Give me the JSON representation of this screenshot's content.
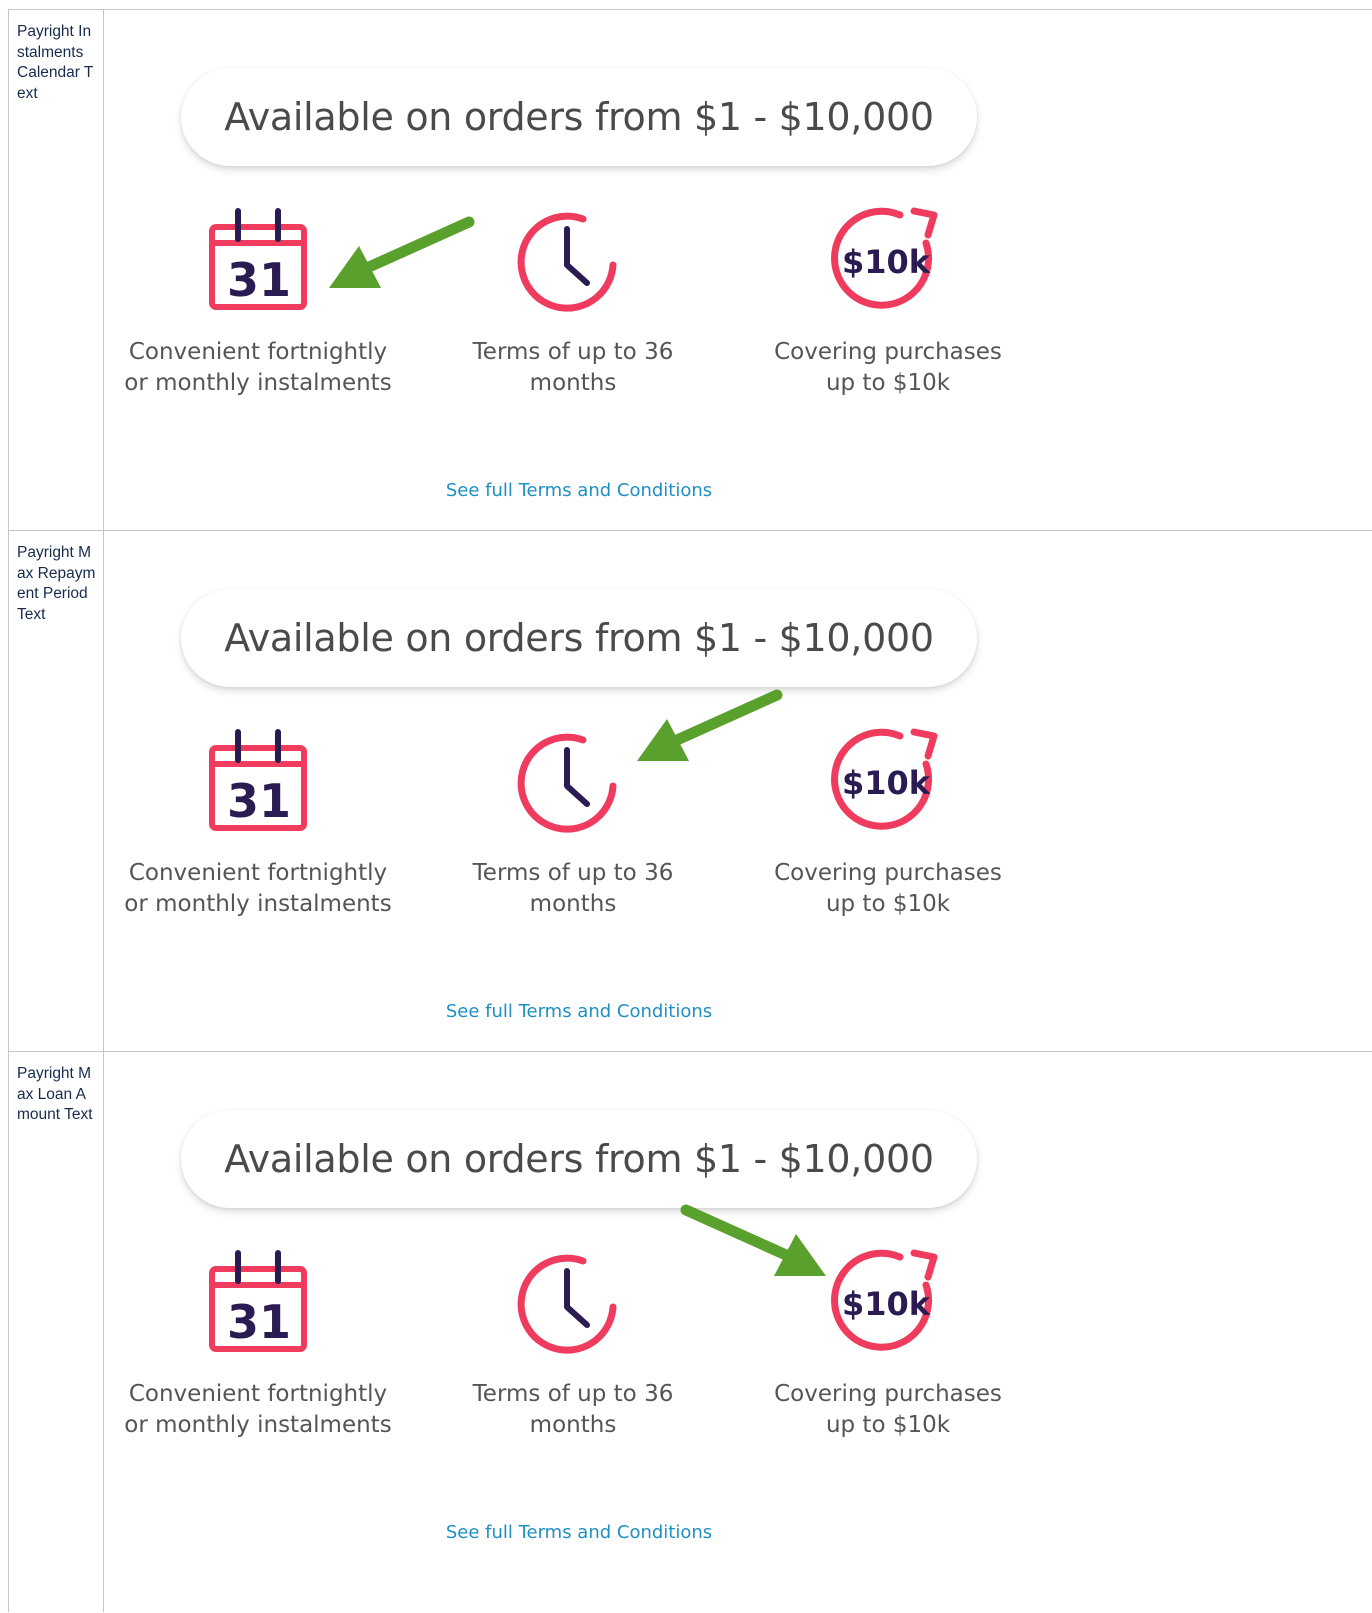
{
  "colors": {
    "accent_red": "#ef3b5d",
    "icon_navy": "#2a1c52",
    "arrow_green": "#5aa02c",
    "link_blue": "#1f8fc4",
    "border": "#c1c7d0"
  },
  "rows": [
    {
      "label": "Payright Instalments Calendar Text",
      "banner": "Available on orders from $1 - $10,000",
      "features": [
        {
          "icon": "calendar-icon",
          "badge": "31",
          "caption": "Convenient fortnightly or monthly instalments"
        },
        {
          "icon": "clock-icon",
          "caption": "Terms of up to 36 months"
        },
        {
          "icon": "dollar-10k-icon",
          "badge": "$10k",
          "caption": "Covering purchases up to $10k"
        }
      ],
      "link": "See full Terms and Conditions",
      "highlighted": "calendar-icon"
    },
    {
      "label": "Payright Max Repayment Period Text",
      "banner": "Available on orders from $1 - $10,000",
      "features": [
        {
          "icon": "calendar-icon",
          "badge": "31",
          "caption": "Convenient fortnightly or monthly instalments"
        },
        {
          "icon": "clock-icon",
          "caption": "Terms of up to 36 months"
        },
        {
          "icon": "dollar-10k-icon",
          "badge": "$10k",
          "caption": "Covering purchases up to $10k"
        }
      ],
      "link": "See full Terms and Conditions",
      "highlighted": "clock-icon"
    },
    {
      "label": "Payright Max Loan Amount Text",
      "banner": "Available on orders from $1 - $10,000",
      "features": [
        {
          "icon": "calendar-icon",
          "badge": "31",
          "caption": "Convenient fortnightly or monthly instalments"
        },
        {
          "icon": "clock-icon",
          "caption": "Terms of up to 36 months"
        },
        {
          "icon": "dollar-10k-icon",
          "badge": "$10k",
          "caption": "Covering purchases up to $10k"
        }
      ],
      "link": "See full Terms and Conditions",
      "highlighted": "dollar-10k-icon"
    }
  ]
}
